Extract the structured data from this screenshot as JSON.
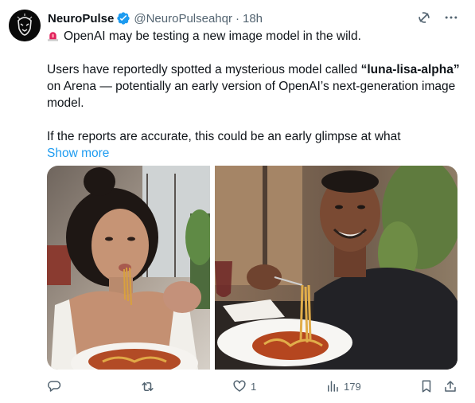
{
  "author": {
    "name": "NeuroPulse",
    "handle": "@NeuroPulseahqr",
    "separator": "·",
    "time": "18h",
    "verified": true
  },
  "tweet": {
    "line1": "OpenAI may be testing a new image model in the wild.",
    "p2_before": "Users have reportedly spotted a mysterious model called ",
    "p2_quote": "“luna-lisa-alpha”",
    "p2_after": " on Arena — potentially an early version of OpenAI’s next-generation image model.",
    "p3": "If the reports are accurate, this could be an early glimpse at what",
    "show_more": "Show more"
  },
  "icons": {
    "alarm": "police-light-icon",
    "grok": "grok-icon",
    "more": "more-icon",
    "reply": "reply-icon",
    "retweet": "retweet-icon",
    "like": "heart-icon",
    "views": "views-icon",
    "bookmark": "bookmark-icon",
    "share": "share-icon"
  },
  "stats": {
    "likes": "1",
    "views": "179"
  },
  "colors": {
    "link": "#1d9bf0",
    "verified": "#1d9bf0",
    "muted": "#536471",
    "text": "#0f1419"
  }
}
